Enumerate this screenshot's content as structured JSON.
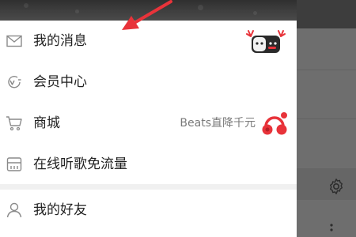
{
  "drawer": {
    "items": [
      {
        "label": "我的消息",
        "icon": "mail-icon"
      },
      {
        "label": "会员中心",
        "icon": "vip-icon"
      },
      {
        "label": "商城",
        "icon": "cart-icon",
        "promo": "Beats直降千元"
      },
      {
        "label": "在线听歌免流量",
        "icon": "sim-card-icon"
      },
      {
        "label": "我的好友",
        "icon": "person-icon"
      }
    ]
  },
  "colors": {
    "accent_red": "#e8333a",
    "icon_gray": "#8a8a8a",
    "text_dark": "#222222",
    "promo_gray": "#7a7a7a",
    "overlay": "#6f6f6f"
  }
}
